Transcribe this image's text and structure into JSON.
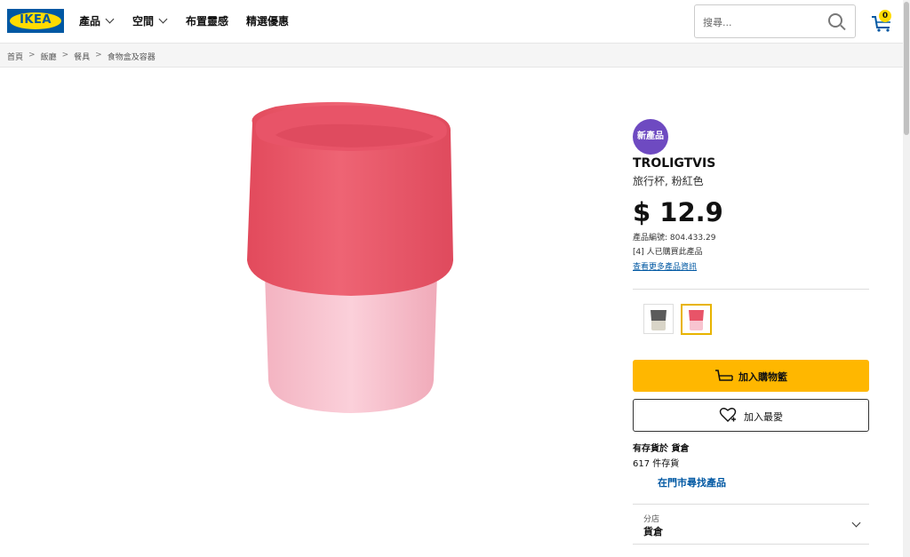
{
  "header": {
    "logo_text": "IKEA",
    "nav": [
      {
        "label": "產品",
        "has_dropdown": true
      },
      {
        "label": "空間",
        "has_dropdown": true
      },
      {
        "label": "布置靈感",
        "has_dropdown": false
      },
      {
        "label": "精選優惠",
        "has_dropdown": false
      }
    ],
    "search_placeholder": "搜尋...",
    "cart_count": "0"
  },
  "breadcrumb": [
    "首頁",
    "飯廳",
    "餐具",
    "食物盒及容器"
  ],
  "breadcrumb_sep": ">",
  "product": {
    "badge": "新產品",
    "name": "TROLIGTVIS",
    "description": "旅行杯, 粉紅色",
    "price": "$ 12.9",
    "sku": "產品編號: 804.433.29",
    "bought": "[4] 人已購買此產品",
    "more_info_link": "查看更多產品資訊",
    "variants": [
      {
        "name": "grey-beige",
        "selected": false
      },
      {
        "name": "pink",
        "selected": true
      }
    ]
  },
  "actions": {
    "add_to_cart": "加入購物籃",
    "add_to_favourites": "加入最愛"
  },
  "stock": {
    "title": "有存貨於 貨倉",
    "count": "617 件存貨",
    "find_in_store": "在門市尋找產品"
  },
  "store_selector": {
    "label": "分店",
    "value": "貨倉"
  },
  "colors": {
    "ikea_blue": "#0058a3",
    "ikea_yellow": "#ffdb00",
    "cart_button": "#ffb700",
    "new_badge": "#6e4ac1",
    "cup_lid": "#ec5c6d",
    "cup_body": "#f9c4cf"
  }
}
